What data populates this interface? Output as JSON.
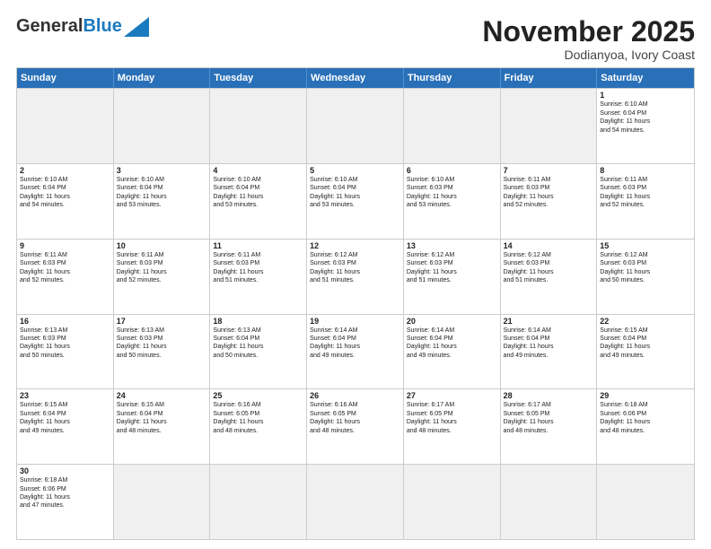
{
  "header": {
    "logo_general": "General",
    "logo_blue": "Blue",
    "month_title": "November 2025",
    "location": "Dodianyoa, Ivory Coast"
  },
  "weekdays": [
    "Sunday",
    "Monday",
    "Tuesday",
    "Wednesday",
    "Thursday",
    "Friday",
    "Saturday"
  ],
  "weeks": [
    [
      {
        "day": "",
        "text": "",
        "empty": true
      },
      {
        "day": "",
        "text": "",
        "empty": true
      },
      {
        "day": "",
        "text": "",
        "empty": true
      },
      {
        "day": "",
        "text": "",
        "empty": true
      },
      {
        "day": "",
        "text": "",
        "empty": true
      },
      {
        "day": "",
        "text": "",
        "empty": true
      },
      {
        "day": "1",
        "text": "Sunrise: 6:10 AM\nSunset: 6:04 PM\nDaylight: 11 hours\nand 54 minutes."
      }
    ],
    [
      {
        "day": "2",
        "text": "Sunrise: 6:10 AM\nSunset: 6:04 PM\nDaylight: 11 hours\nand 54 minutes."
      },
      {
        "day": "3",
        "text": "Sunrise: 6:10 AM\nSunset: 6:04 PM\nDaylight: 11 hours\nand 53 minutes."
      },
      {
        "day": "4",
        "text": "Sunrise: 6:10 AM\nSunset: 6:04 PM\nDaylight: 11 hours\nand 53 minutes."
      },
      {
        "day": "5",
        "text": "Sunrise: 6:10 AM\nSunset: 6:04 PM\nDaylight: 11 hours\nand 53 minutes."
      },
      {
        "day": "6",
        "text": "Sunrise: 6:10 AM\nSunset: 6:03 PM\nDaylight: 11 hours\nand 53 minutes."
      },
      {
        "day": "7",
        "text": "Sunrise: 6:11 AM\nSunset: 6:03 PM\nDaylight: 11 hours\nand 52 minutes."
      },
      {
        "day": "8",
        "text": "Sunrise: 6:11 AM\nSunset: 6:03 PM\nDaylight: 11 hours\nand 52 minutes."
      }
    ],
    [
      {
        "day": "9",
        "text": "Sunrise: 6:11 AM\nSunset: 6:03 PM\nDaylight: 11 hours\nand 52 minutes."
      },
      {
        "day": "10",
        "text": "Sunrise: 6:11 AM\nSunset: 6:03 PM\nDaylight: 11 hours\nand 52 minutes."
      },
      {
        "day": "11",
        "text": "Sunrise: 6:11 AM\nSunset: 6:03 PM\nDaylight: 11 hours\nand 51 minutes."
      },
      {
        "day": "12",
        "text": "Sunrise: 6:12 AM\nSunset: 6:03 PM\nDaylight: 11 hours\nand 51 minutes."
      },
      {
        "day": "13",
        "text": "Sunrise: 6:12 AM\nSunset: 6:03 PM\nDaylight: 11 hours\nand 51 minutes."
      },
      {
        "day": "14",
        "text": "Sunrise: 6:12 AM\nSunset: 6:03 PM\nDaylight: 11 hours\nand 51 minutes."
      },
      {
        "day": "15",
        "text": "Sunrise: 6:12 AM\nSunset: 6:03 PM\nDaylight: 11 hours\nand 50 minutes."
      }
    ],
    [
      {
        "day": "16",
        "text": "Sunrise: 6:13 AM\nSunset: 6:03 PM\nDaylight: 11 hours\nand 50 minutes."
      },
      {
        "day": "17",
        "text": "Sunrise: 6:13 AM\nSunset: 6:03 PM\nDaylight: 11 hours\nand 50 minutes."
      },
      {
        "day": "18",
        "text": "Sunrise: 6:13 AM\nSunset: 6:04 PM\nDaylight: 11 hours\nand 50 minutes."
      },
      {
        "day": "19",
        "text": "Sunrise: 6:14 AM\nSunset: 6:04 PM\nDaylight: 11 hours\nand 49 minutes."
      },
      {
        "day": "20",
        "text": "Sunrise: 6:14 AM\nSunset: 6:04 PM\nDaylight: 11 hours\nand 49 minutes."
      },
      {
        "day": "21",
        "text": "Sunrise: 6:14 AM\nSunset: 6:04 PM\nDaylight: 11 hours\nand 49 minutes."
      },
      {
        "day": "22",
        "text": "Sunrise: 6:15 AM\nSunset: 6:04 PM\nDaylight: 11 hours\nand 49 minutes."
      }
    ],
    [
      {
        "day": "23",
        "text": "Sunrise: 6:15 AM\nSunset: 6:04 PM\nDaylight: 11 hours\nand 49 minutes."
      },
      {
        "day": "24",
        "text": "Sunrise: 6:15 AM\nSunset: 6:04 PM\nDaylight: 11 hours\nand 48 minutes."
      },
      {
        "day": "25",
        "text": "Sunrise: 6:16 AM\nSunset: 6:05 PM\nDaylight: 11 hours\nand 48 minutes."
      },
      {
        "day": "26",
        "text": "Sunrise: 6:16 AM\nSunset: 6:05 PM\nDaylight: 11 hours\nand 48 minutes."
      },
      {
        "day": "27",
        "text": "Sunrise: 6:17 AM\nSunset: 6:05 PM\nDaylight: 11 hours\nand 48 minutes."
      },
      {
        "day": "28",
        "text": "Sunrise: 6:17 AM\nSunset: 6:05 PM\nDaylight: 11 hours\nand 48 minutes."
      },
      {
        "day": "29",
        "text": "Sunrise: 6:18 AM\nSunset: 6:06 PM\nDaylight: 11 hours\nand 48 minutes."
      }
    ],
    [
      {
        "day": "30",
        "text": "Sunrise: 6:18 AM\nSunset: 6:06 PM\nDaylight: 11 hours\nand 47 minutes."
      },
      {
        "day": "",
        "text": "",
        "empty": true
      },
      {
        "day": "",
        "text": "",
        "empty": true
      },
      {
        "day": "",
        "text": "",
        "empty": true
      },
      {
        "day": "",
        "text": "",
        "empty": true
      },
      {
        "day": "",
        "text": "",
        "empty": true
      },
      {
        "day": "",
        "text": "",
        "empty": true
      }
    ]
  ]
}
